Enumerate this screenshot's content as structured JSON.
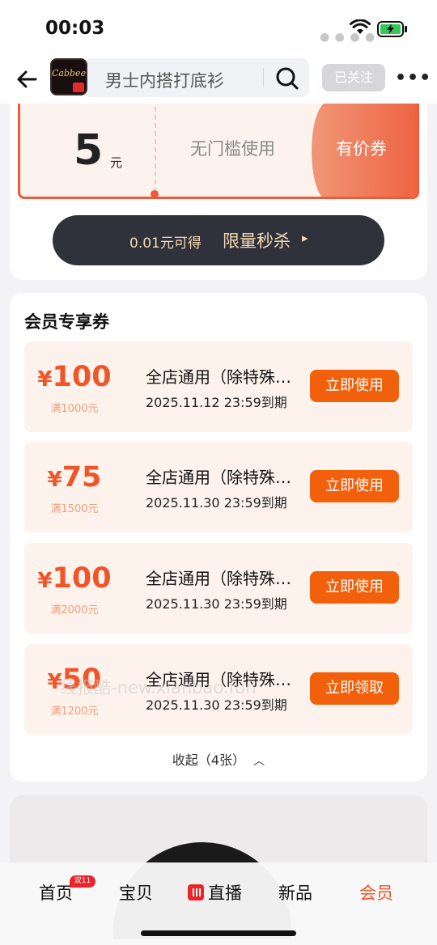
{
  "status": {
    "time": "00:03"
  },
  "header": {
    "logo_text": "Cabbeen",
    "search_text": "男士内搭打底衫",
    "follow_label": "已关注"
  },
  "coupon_card": {
    "amount": "5",
    "unit": "元",
    "description": "无门槛使用",
    "type": "有价券",
    "flash_price": "0.01元可得",
    "flash_label": "限量秒杀"
  },
  "member": {
    "title": "会员专享券",
    "coupons": [
      {
        "currency": "¥",
        "amount": "100",
        "condition": "满1000元",
        "title": "全店通用（除特殊…",
        "expiry": "2025.11.12 23:59到期",
        "button": "立即使用"
      },
      {
        "currency": "¥",
        "amount": "75",
        "condition": "满1500元",
        "title": "全店通用（除特殊…",
        "expiry": "2025.11.30 23:59到期",
        "button": "立即使用"
      },
      {
        "currency": "¥",
        "amount": "100",
        "condition": "满2000元",
        "title": "全店通用（除特殊…",
        "expiry": "2025.11.30 23:59到期",
        "button": "立即使用"
      },
      {
        "currency": "¥",
        "amount": "50",
        "condition": "满1200元",
        "title": "全店通用（除特殊…",
        "expiry": "2025.11.30 23:59到期",
        "button": "立即领取"
      }
    ],
    "collapse_label": "收起（4张）",
    "watermark": "线报酷-new.xianbao.fun"
  },
  "tabbar": {
    "tabs": [
      "首页",
      "宝贝",
      "直播",
      "新品",
      "会员"
    ],
    "badge": "双11",
    "active": "会员"
  },
  "colors": {
    "accent": "#f0552a",
    "button": "#f2600b",
    "dark_pill": "#2f323a"
  }
}
